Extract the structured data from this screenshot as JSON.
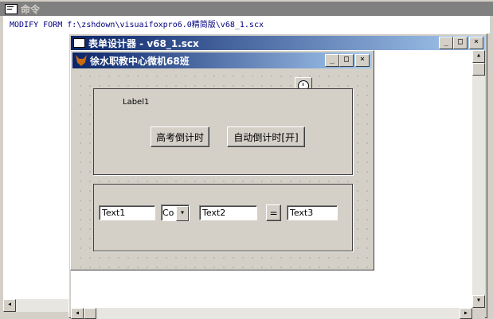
{
  "command_window": {
    "title": "命令",
    "command_text": "MODIFY FORM f:\\zshdown\\visuaifoxpro6.0精简版\\v68_1.scx"
  },
  "designer_window": {
    "title": "表单设计器 - v68_1.scx"
  },
  "form": {
    "caption": "徐水职教中心微机68班",
    "label1": "Label1",
    "button1": "高考倒计时",
    "button2": "自动倒计时[开]",
    "text1": "Text1",
    "combo": "Co",
    "text2": "Text2",
    "equals_button": "=",
    "text3": "Text3"
  },
  "colors": {
    "title_active_start": "#0a246a",
    "title_active_end": "#a6caf0",
    "title_inactive": "#808080"
  }
}
